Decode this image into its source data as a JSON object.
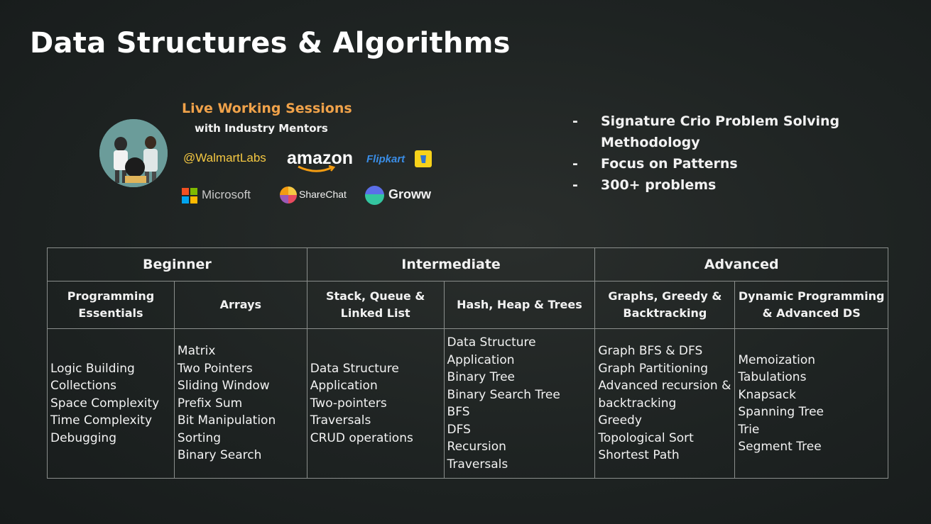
{
  "title": "Data Structures & Algorithms",
  "sessions": {
    "title": "Live Working Sessions",
    "subtitle": "with Industry Mentors",
    "logos": {
      "walmart": "@WalmartLabs",
      "amazon": "amazon",
      "flipkart": "Flipkart",
      "microsoft": "Microsoft",
      "sharechat": "ShareChat",
      "groww": "Groww"
    }
  },
  "highlights": [
    "Signature Crio Problem Solving Methodology",
    "Focus on Patterns",
    "300+ problems"
  ],
  "bullet_marker": "-",
  "levels": [
    "Beginner",
    "Intermediate",
    "Advanced"
  ],
  "categories": [
    {
      "label": "Programming Essentials",
      "topics": [
        "Logic Building",
        "Collections",
        "Space Complexity",
        "Time Complexity",
        "Debugging"
      ]
    },
    {
      "label": "Arrays",
      "topics": [
        "Matrix",
        "Two Pointers",
        "Sliding Window",
        "Prefix Sum",
        "Bit Manipulation",
        "Sorting",
        "Binary Search"
      ]
    },
    {
      "label": "Stack, Queue & Linked List",
      "topics": [
        "Data Structure",
        "Application",
        "Two-pointers",
        "Traversals",
        "CRUD operations"
      ]
    },
    {
      "label": "Hash, Heap & Trees",
      "topics": [
        "Data Structure",
        "Application",
        "Binary Tree",
        "Binary Search Tree",
        "BFS",
        "DFS",
        "Recursion",
        "Traversals"
      ]
    },
    {
      "label": "Graphs, Greedy & Backtracking",
      "topics": [
        "Graph BFS & DFS",
        "Graph Partitioning",
        "Advanced recursion &",
        "backtracking",
        "Greedy",
        "Topological Sort",
        "Shortest Path"
      ]
    },
    {
      "label": "Dynamic Programming & Advanced DS",
      "topics": [
        "Memoization",
        "Tabulations",
        "Knapsack",
        "Spanning Tree",
        "Trie",
        "Segment Tree"
      ]
    }
  ],
  "colors": {
    "background": "#1e2322",
    "accent": "#f0a24a",
    "text": "#f2f2f2",
    "table_border": "#8a8e8c"
  }
}
